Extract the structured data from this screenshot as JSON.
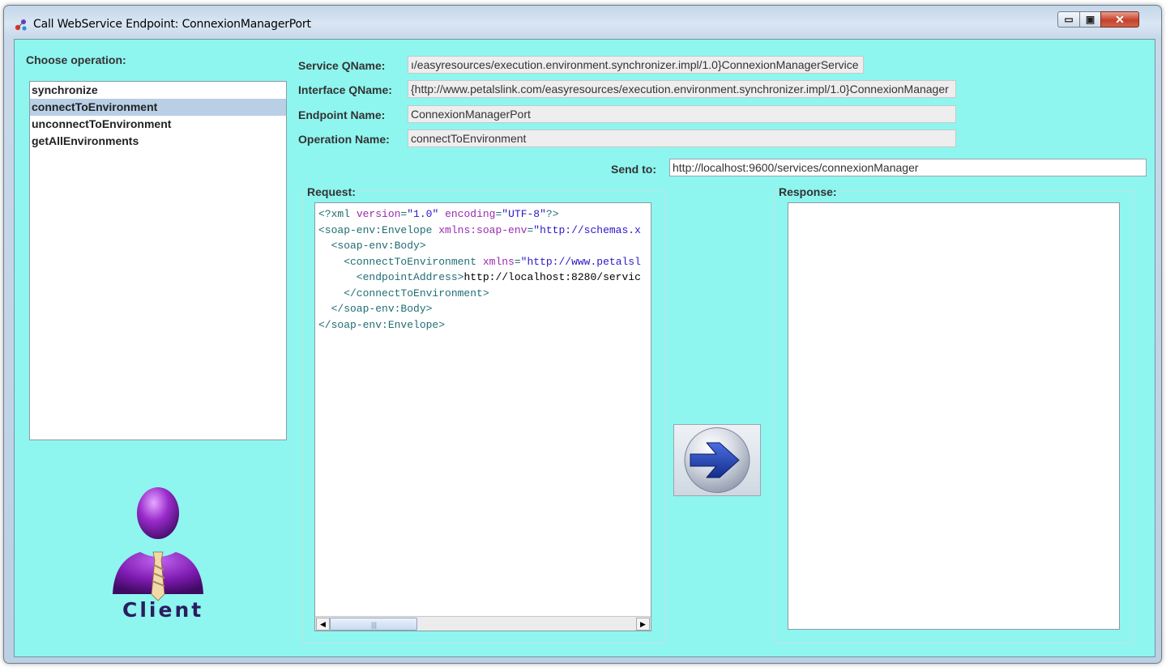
{
  "window": {
    "title": "Call WebService Endpoint: ConnexionManagerPort",
    "controls": {
      "minimize": "▭",
      "maximize": "▣",
      "close": "✕"
    }
  },
  "operations": {
    "label": "Choose operation:",
    "items": [
      "synchronize",
      "connectToEnvironment",
      "unconnectToEnvironment",
      "getAllEnvironments"
    ],
    "selected": "connectToEnvironment"
  },
  "details": {
    "service_qname_label": "Service QName:",
    "service_qname_value": "ı/easyresources/execution.environment.synchronizer.impl/1.0}ConnexionManagerService",
    "interface_qname_label": "Interface QName:",
    "interface_qname_value": "{http://www.petalslink.com/easyresources/execution.environment.synchronizer.impl/1.0}ConnexionManager",
    "endpoint_name_label": "Endpoint Name:",
    "endpoint_name_value": "ConnexionManagerPort",
    "operation_name_label": "Operation Name:",
    "operation_name_value": "connectToEnvironment"
  },
  "send_to": {
    "label": "Send to:",
    "value": "http://localhost:9600/services/connexionManager"
  },
  "request": {
    "label": "Request:",
    "lines": [
      "<?xml version=\"1.0\" encoding=\"UTF-8\"?>",
      "<soap-env:Envelope xmlns:soap-env=\"http://schemas.x",
      "  <soap-env:Body>",
      "    <connectToEnvironment xmlns=\"http://www.petalsl",
      "      <endpointAddress>http://localhost:8280/servic",
      "    </connectToEnvironment>",
      "  </soap-env:Body>",
      "</soap-env:Envelope>"
    ]
  },
  "response": {
    "label": "Response:"
  },
  "client": {
    "label": "Client"
  },
  "colors": {
    "background": "#8ff5ef",
    "selection": "#b8cfe5",
    "client_purple": "#8a1fb8",
    "arrow_blue": "#1f3ea8"
  },
  "icons": {
    "send": "arrow-right-icon",
    "client": "client-person-icon",
    "app": "app-icon"
  }
}
